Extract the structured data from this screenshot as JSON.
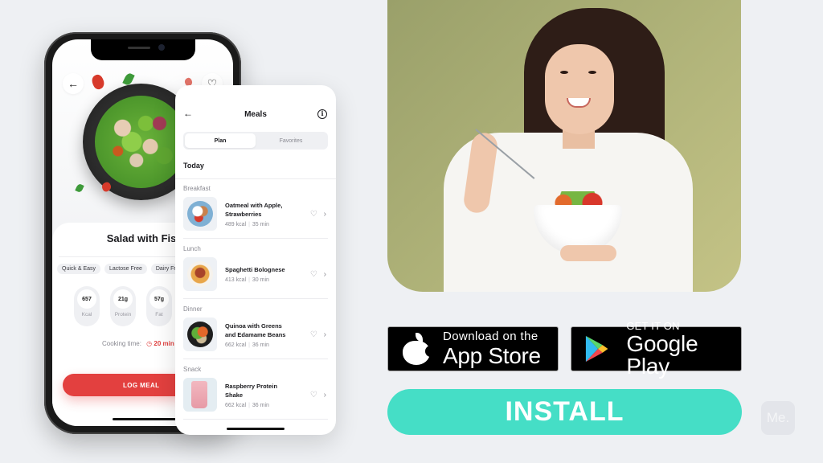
{
  "colors": {
    "background": "#eef0f3",
    "accent_red": "#e3403f",
    "install_teal": "#45dec6",
    "hero_background": "#b1b47a"
  },
  "recipe_screen": {
    "back_icon": "arrow-left",
    "favorite_icon": "heart-outline",
    "title": "Salad with Fish",
    "tags": [
      "Quick & Easy",
      "Lactose Free",
      "Dairy Free"
    ],
    "nutrients": [
      {
        "value": "657",
        "label": "Kcal"
      },
      {
        "value": "21g",
        "label": "Protein"
      },
      {
        "value": "57g",
        "label": "Fat"
      }
    ],
    "cooking_time_label": "Cooking time:",
    "cooking_time_value": "20 min",
    "log_meal_button": "LOG MEAL"
  },
  "meals_screen": {
    "back_icon": "arrow-left",
    "title": "Meals",
    "info_icon": "info-circle",
    "tabs": [
      {
        "label": "Plan",
        "active": true
      },
      {
        "label": "Favorites",
        "active": false
      }
    ],
    "day_label": "Today",
    "sections": [
      {
        "label": "Breakfast",
        "meal": {
          "name_line1": "Oatmeal with Apple,",
          "name_line2": "Strawberries",
          "kcal": "489 kcal",
          "time": "35 min"
        }
      },
      {
        "label": "Lunch",
        "meal": {
          "name_line1": "Spaghetti Bolognese",
          "name_line2": "",
          "kcal": "413 kcal",
          "time": "30 min"
        }
      },
      {
        "label": "Dinner",
        "meal": {
          "name_line1": "Quinoa with Greens",
          "name_line2": "and Edamame Beans",
          "kcal": "662 kcal",
          "time": "36 min"
        }
      },
      {
        "label": "Snack",
        "meal": {
          "name_line1": "Raspberry Protein",
          "name_line2": "Shake",
          "kcal": "662 kcal",
          "time": "36 min"
        }
      }
    ]
  },
  "store_badges": {
    "apple": {
      "small": "Download on the",
      "big": "App Store"
    },
    "google": {
      "small": "GET IT ON",
      "big": "Google Play"
    }
  },
  "install_button": "INSTALL",
  "brand_logo": "Me."
}
